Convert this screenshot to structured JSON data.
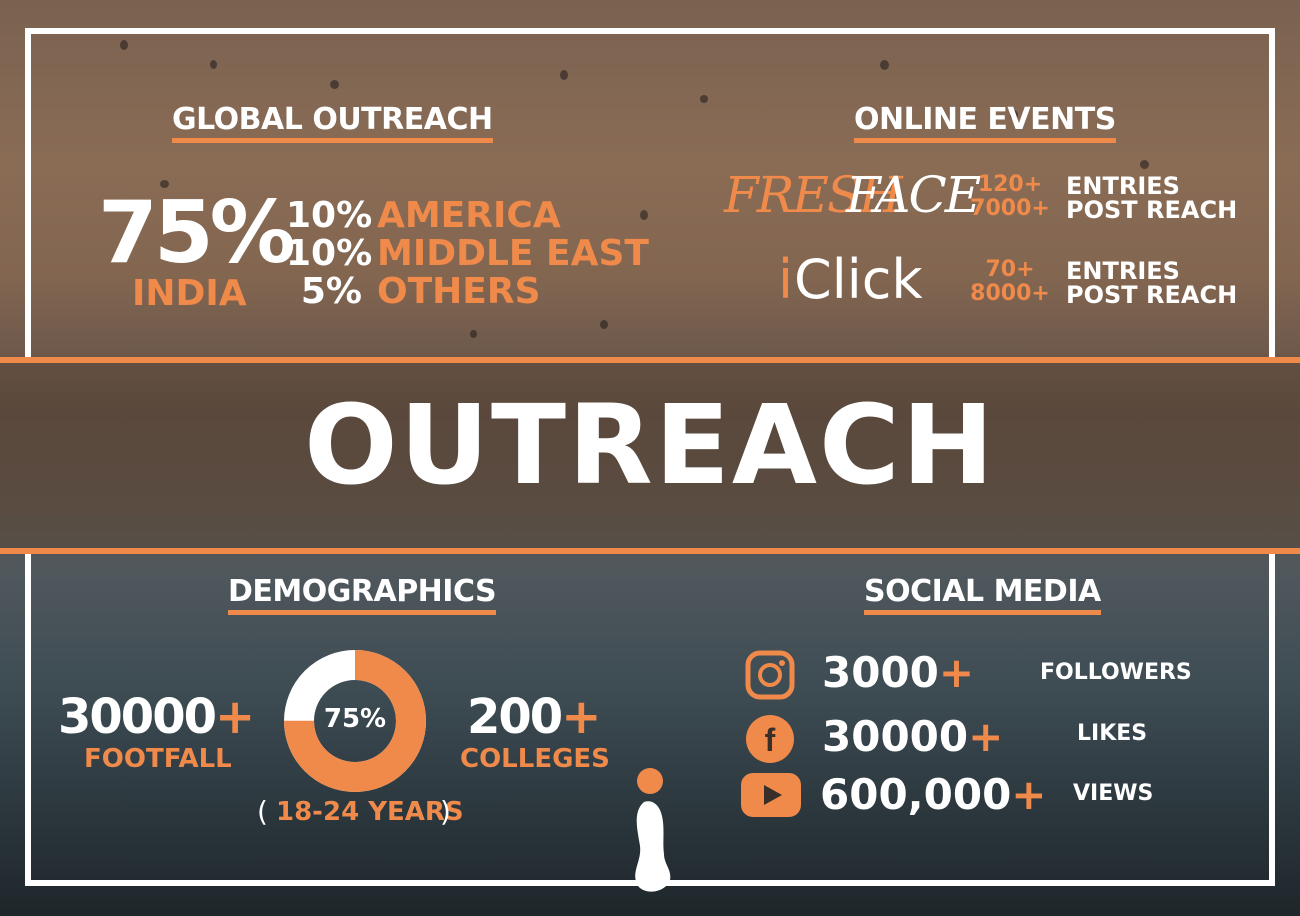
{
  "colors": {
    "accent": "#f08a4b",
    "text": "#ffffff"
  },
  "global_outreach": {
    "heading": "GLOBAL OUTREACH",
    "india_pct": "75%",
    "india_label": "INDIA",
    "regions": [
      {
        "pct": "10%",
        "name": "AMERICA"
      },
      {
        "pct": "10%",
        "name": "MIDDLE EAST"
      },
      {
        "pct": "5%",
        "name": "OTHERS"
      }
    ]
  },
  "online_events": {
    "heading": "ONLINE EVENTS",
    "events": [
      {
        "logo_a": "FRESH",
        "logo_b": "FACE",
        "count1": "120+",
        "label1": "ENTRIES",
        "count2": "7000+",
        "label2": "POST REACH"
      },
      {
        "logo_a": "i",
        "logo_b": "Click",
        "count1": "70+",
        "label1": "ENTRIES",
        "count2": "8000+",
        "label2": "POST REACH"
      }
    ]
  },
  "title": "OUTREACH",
  "demographics": {
    "heading": "DEMOGRAPHICS",
    "footfall_value": "30000+",
    "footfall_label": "FOOTFALL",
    "donut_pct": "75%",
    "donut_fraction": 0.75,
    "age_open": "(",
    "age_range": "18-24 YEARS",
    "age_close": ")",
    "colleges_value": "200+",
    "colleges_label": "COLLEGES"
  },
  "social_media": {
    "heading": "SOCIAL MEDIA",
    "rows": [
      {
        "icon": "instagram-icon",
        "value": "3000+",
        "label": "FOLLOWERS"
      },
      {
        "icon": "facebook-icon",
        "value": "30000+",
        "label": "LIKES"
      },
      {
        "icon": "youtube-icon",
        "value": "600,000+",
        "label": "VIEWS"
      }
    ]
  },
  "logo": "i"
}
